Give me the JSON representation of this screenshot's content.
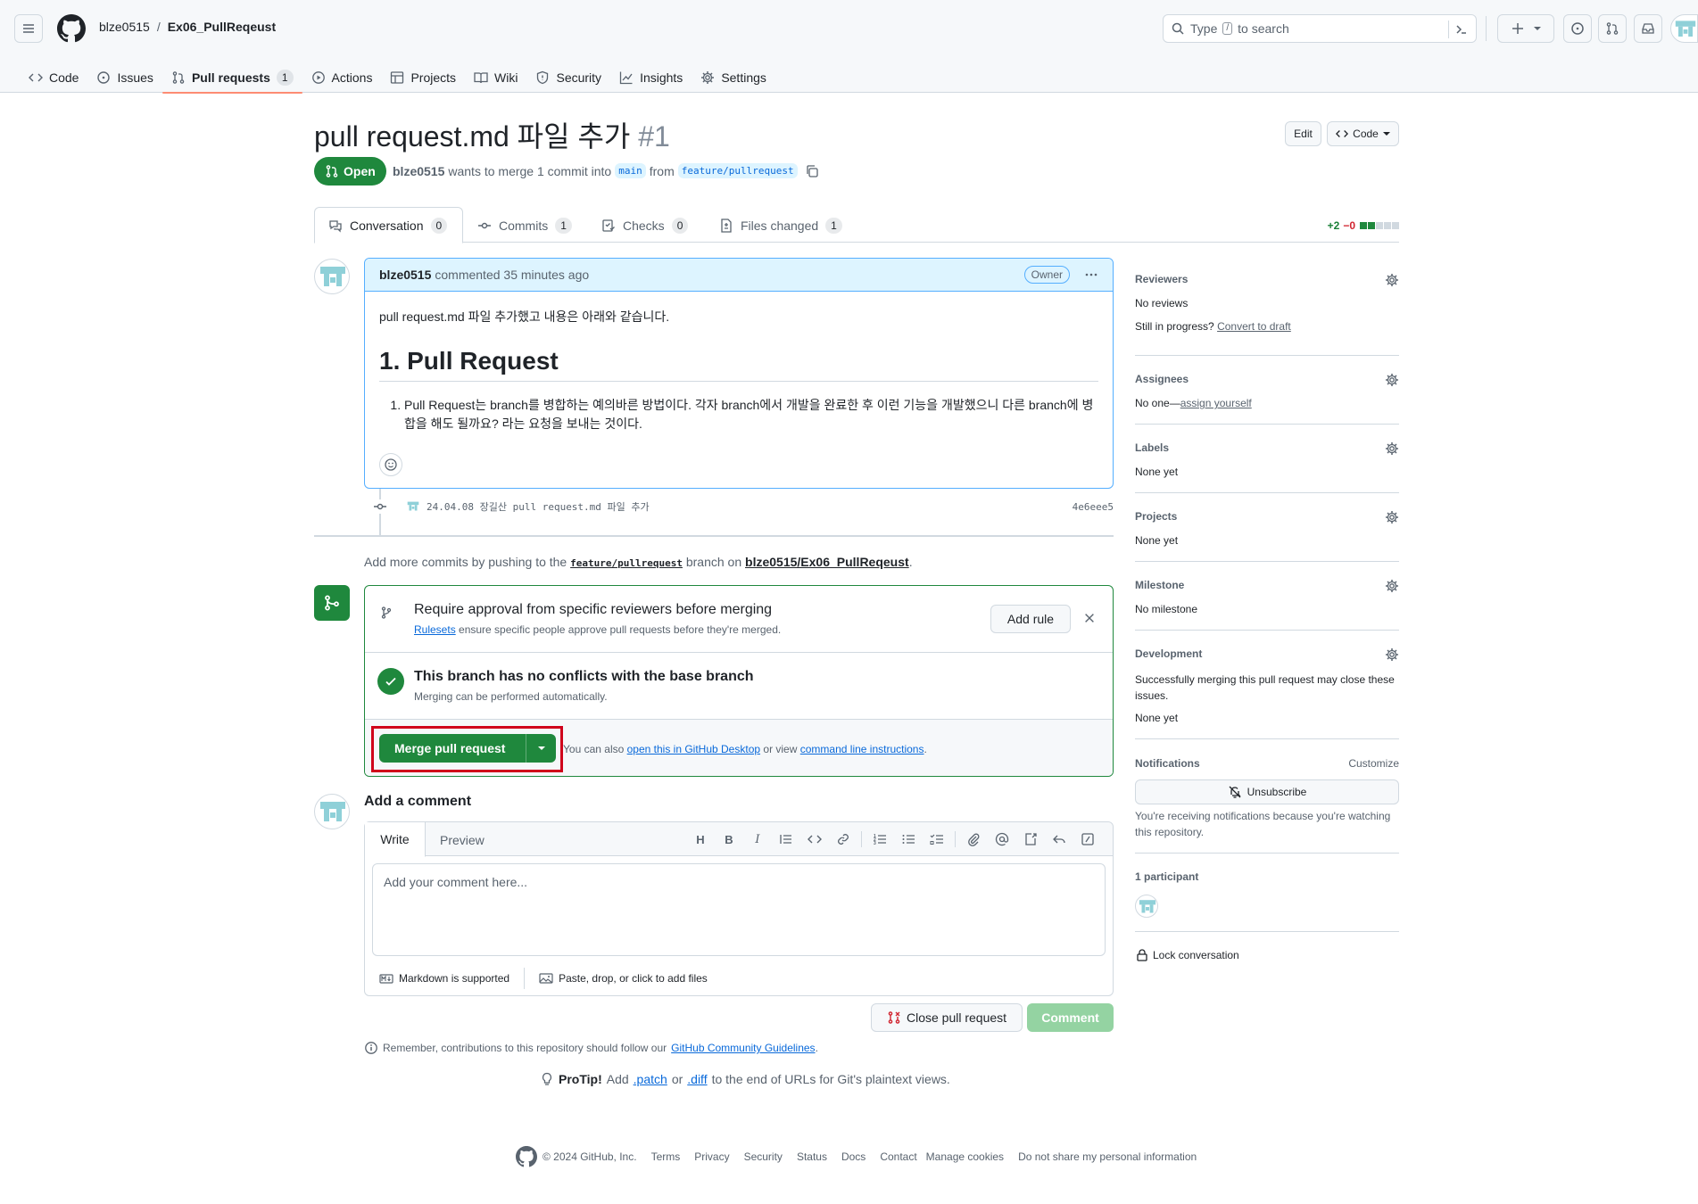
{
  "header": {
    "owner": "blze0515",
    "separator": "/",
    "repo": "Ex06_PullReqeust",
    "search_prefix": "Type",
    "search_key": "/",
    "search_suffix": "to search"
  },
  "repo_tabs": [
    {
      "label": "Code",
      "icon": "code-icon"
    },
    {
      "label": "Issues",
      "icon": "issue-icon"
    },
    {
      "label": "Pull requests",
      "icon": "pull-request-icon",
      "count": "1",
      "active": true
    },
    {
      "label": "Actions",
      "icon": "play-icon"
    },
    {
      "label": "Projects",
      "icon": "table-icon"
    },
    {
      "label": "Wiki",
      "icon": "book-icon"
    },
    {
      "label": "Security",
      "icon": "shield-icon"
    },
    {
      "label": "Insights",
      "icon": "graph-icon"
    },
    {
      "label": "Settings",
      "icon": "gear-icon"
    }
  ],
  "pr": {
    "title": "pull request.md 파일 추가",
    "number": "#1",
    "state": "Open",
    "author": "blze0515",
    "merge_text": "wants to merge 1 commit into",
    "base_branch": "main",
    "from_text": "from",
    "head_branch": "feature/pullrequest",
    "edit_label": "Edit",
    "code_label": "Code"
  },
  "pr_tabs": [
    {
      "label": "Conversation",
      "count": "0",
      "icon": "comment-discussion-icon"
    },
    {
      "label": "Commits",
      "count": "1",
      "icon": "commit-icon"
    },
    {
      "label": "Checks",
      "count": "0",
      "icon": "checklist-icon"
    },
    {
      "label": "Files changed",
      "count": "1",
      "icon": "file-diff-icon"
    }
  ],
  "diffstat": {
    "additions": "+2",
    "deletions": "−0"
  },
  "comment": {
    "author": "blze0515",
    "action": "commented 35 minutes ago",
    "badge": "Owner",
    "intro": "pull request.md 파일 추가했고 내용은 아래와 같습니다.",
    "heading": "1. Pull Request",
    "list_item": "Pull Request는 branch를 병합하는 예의바른 방법이다. 각자 branch에서 개발을 완료한 후 이런 기능을 개발했으니 다른 branch에 병합을 해도 될까요? 라는 요청을 보내는 것이다."
  },
  "commit": {
    "message": "24.04.08 장길산 pull request.md 파일 추가",
    "sha": "4e6eee5"
  },
  "push_hint": {
    "prefix": "Add more commits by pushing to the",
    "branch": "feature/pullrequest",
    "middle": "branch on",
    "repo": "blze0515/Ex06_PullReqeust",
    "suffix": "."
  },
  "merge_box": {
    "rule_title": "Require approval from specific reviewers before merging",
    "rule_link": "Rulesets",
    "rule_sub": "ensure specific people approve pull requests before they're merged.",
    "add_rule": "Add rule",
    "status_title": "This branch has no conflicts with the base branch",
    "status_sub": "Merging can be performed automatically.",
    "merge_button": "Merge pull request",
    "alt_prefix": "You can also",
    "alt_link1": "open this in GitHub Desktop",
    "alt_middle": "or view",
    "alt_link2": "command line instructions",
    "alt_suffix": "."
  },
  "add_comment": {
    "title": "Add a comment",
    "tab_write": "Write",
    "tab_preview": "Preview",
    "placeholder": "Add your comment here...",
    "markdown": "Markdown is supported",
    "attach": "Paste, drop, or click to add files",
    "close_button": "Close pull request",
    "comment_button": "Comment"
  },
  "guidelines": {
    "prefix": "Remember, contributions to this repository should follow our",
    "link": "GitHub Community Guidelines",
    "suffix": "."
  },
  "protip": {
    "label": "ProTip!",
    "text1": "Add",
    "patch": ".patch",
    "text2": "or",
    "diff": ".diff",
    "text3": "to the end of URLs for Git's plaintext views."
  },
  "sidebar": {
    "reviewers_title": "Reviewers",
    "reviewers_value": "No reviews",
    "reviewers_progress": "Still in progress?",
    "reviewers_draft": "Convert to draft",
    "assignees_title": "Assignees",
    "assignees_value": "No one—",
    "assignees_link": "assign yourself",
    "labels_title": "Labels",
    "labels_value": "None yet",
    "projects_title": "Projects",
    "projects_value": "None yet",
    "milestone_title": "Milestone",
    "milestone_value": "No milestone",
    "development_title": "Development",
    "development_text": "Successfully merging this pull request may close these issues.",
    "development_value": "None yet",
    "notifications_title": "Notifications",
    "notifications_customize": "Customize",
    "unsubscribe": "Unsubscribe",
    "notifications_reason": "You're receiving notifications because you're watching this repository.",
    "participants": "1 participant",
    "lock": "Lock conversation"
  },
  "footer": {
    "copyright": "© 2024 GitHub, Inc.",
    "links": [
      "Terms",
      "Privacy",
      "Security",
      "Status",
      "Docs",
      "Contact",
      "Manage cookies",
      "Do not share my personal information"
    ]
  },
  "colors": {
    "accent_green": "#1f883d",
    "link_blue": "#0969da",
    "highlight_red": "#d0021b",
    "active_tab_underline": "#fd8c73"
  }
}
